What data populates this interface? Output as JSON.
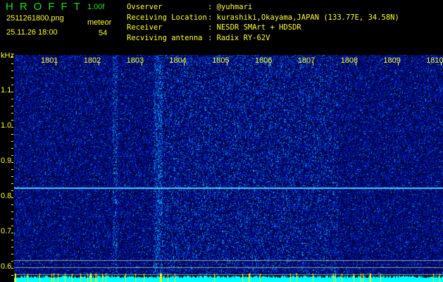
{
  "header": {
    "title": "HROFFT",
    "version": "1.00f",
    "filename": "2511261800.png",
    "datetime": "25.11.26 18:00",
    "meteor_label": "meteor",
    "meteor_count": "54"
  },
  "info": [
    {
      "label": "Ovserver",
      "value": ": @yuhmari"
    },
    {
      "label": "Receiving Location",
      "value": ": kurashiki,Okayama,JAPAN (133.77E, 34.58N)"
    },
    {
      "label": "Receiver",
      "value": ": NESDR SMArt + HDSDR"
    },
    {
      "label": "Recviving antenna",
      "value": ": Radix RY-62V"
    }
  ],
  "axis": {
    "y_unit": "kHz",
    "x_labels": [
      "1801",
      "1802",
      "1803",
      "1804",
      "1805",
      "1806",
      "1807",
      "1808",
      "1809",
      "1810"
    ],
    "y_labels": [
      "1.1",
      "1.0",
      "0.9",
      "0.8",
      "0.7",
      "0.6"
    ]
  },
  "colors": {
    "text": "#ffff33",
    "title": "#22dd22",
    "spectrum": "#00ffff",
    "signal_line": "#40c0ff"
  }
}
